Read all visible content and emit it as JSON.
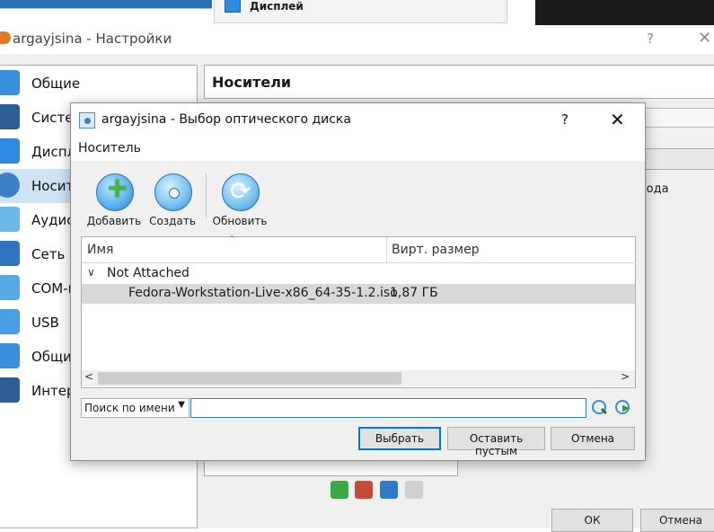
{
  "background": {
    "prev_display_label": "Дисплей",
    "settings_window": {
      "title": "argayjsina - Настройки",
      "help": "?",
      "close": "✕"
    },
    "sidebar": [
      {
        "label": "Общие",
        "icon": "general-icon",
        "color": "#3a8fdc",
        "active": false
      },
      {
        "label": "Систем",
        "icon": "system-icon",
        "color": "#2c5e93",
        "active": false
      },
      {
        "label": "Диспл",
        "icon": "display-icon",
        "color": "#2d8ae0",
        "active": false
      },
      {
        "label": "Носит",
        "icon": "storage-icon",
        "color": "#3c80c8",
        "active": true
      },
      {
        "label": "Аудио",
        "icon": "audio-icon",
        "color": "#6cb8ea",
        "active": false
      },
      {
        "label": "Сеть",
        "icon": "network-icon",
        "color": "#2f74c0",
        "active": false
      },
      {
        "label": "COM-п",
        "icon": "serial-port-icon",
        "color": "#57a9e6",
        "active": false
      },
      {
        "label": "USB",
        "icon": "usb-icon",
        "color": "#4a9ee3",
        "active": false
      },
      {
        "label": "Общи",
        "icon": "shared-folders-icon",
        "color": "#3a8fdc",
        "active": false
      },
      {
        "label": "Интер",
        "icon": "user-interface-icon",
        "color": "#2c5e93",
        "active": false
      }
    ],
    "storage_header": "Носители",
    "right_panel_fragment": "вода",
    "ok": "ОК",
    "cancel": "Отмена"
  },
  "dialog": {
    "title": "argayjsina - Выбор оптического диска",
    "help": "?",
    "close": "✕",
    "menu": "Носитель",
    "toolbar": [
      {
        "label": "Добавить",
        "icon": "add-disk-icon"
      },
      {
        "label": "Создать",
        "icon": "create-disk-icon"
      },
      {
        "label": "Обновить",
        "icon": "refresh-icon"
      }
    ],
    "table": {
      "columns": [
        "Имя",
        "Вирт. размер"
      ],
      "group": "Not Attached",
      "rows": [
        {
          "name": "Fedora-Workstation-Live-x86_64-35-1.2.iso",
          "size": "1,87 ГБ"
        }
      ]
    },
    "search": {
      "mode": "Поиск по имени",
      "value": ""
    },
    "buttons": {
      "choose": "Выбрать",
      "leave_empty": "Оставить пустым",
      "cancel": "Отмена"
    }
  }
}
